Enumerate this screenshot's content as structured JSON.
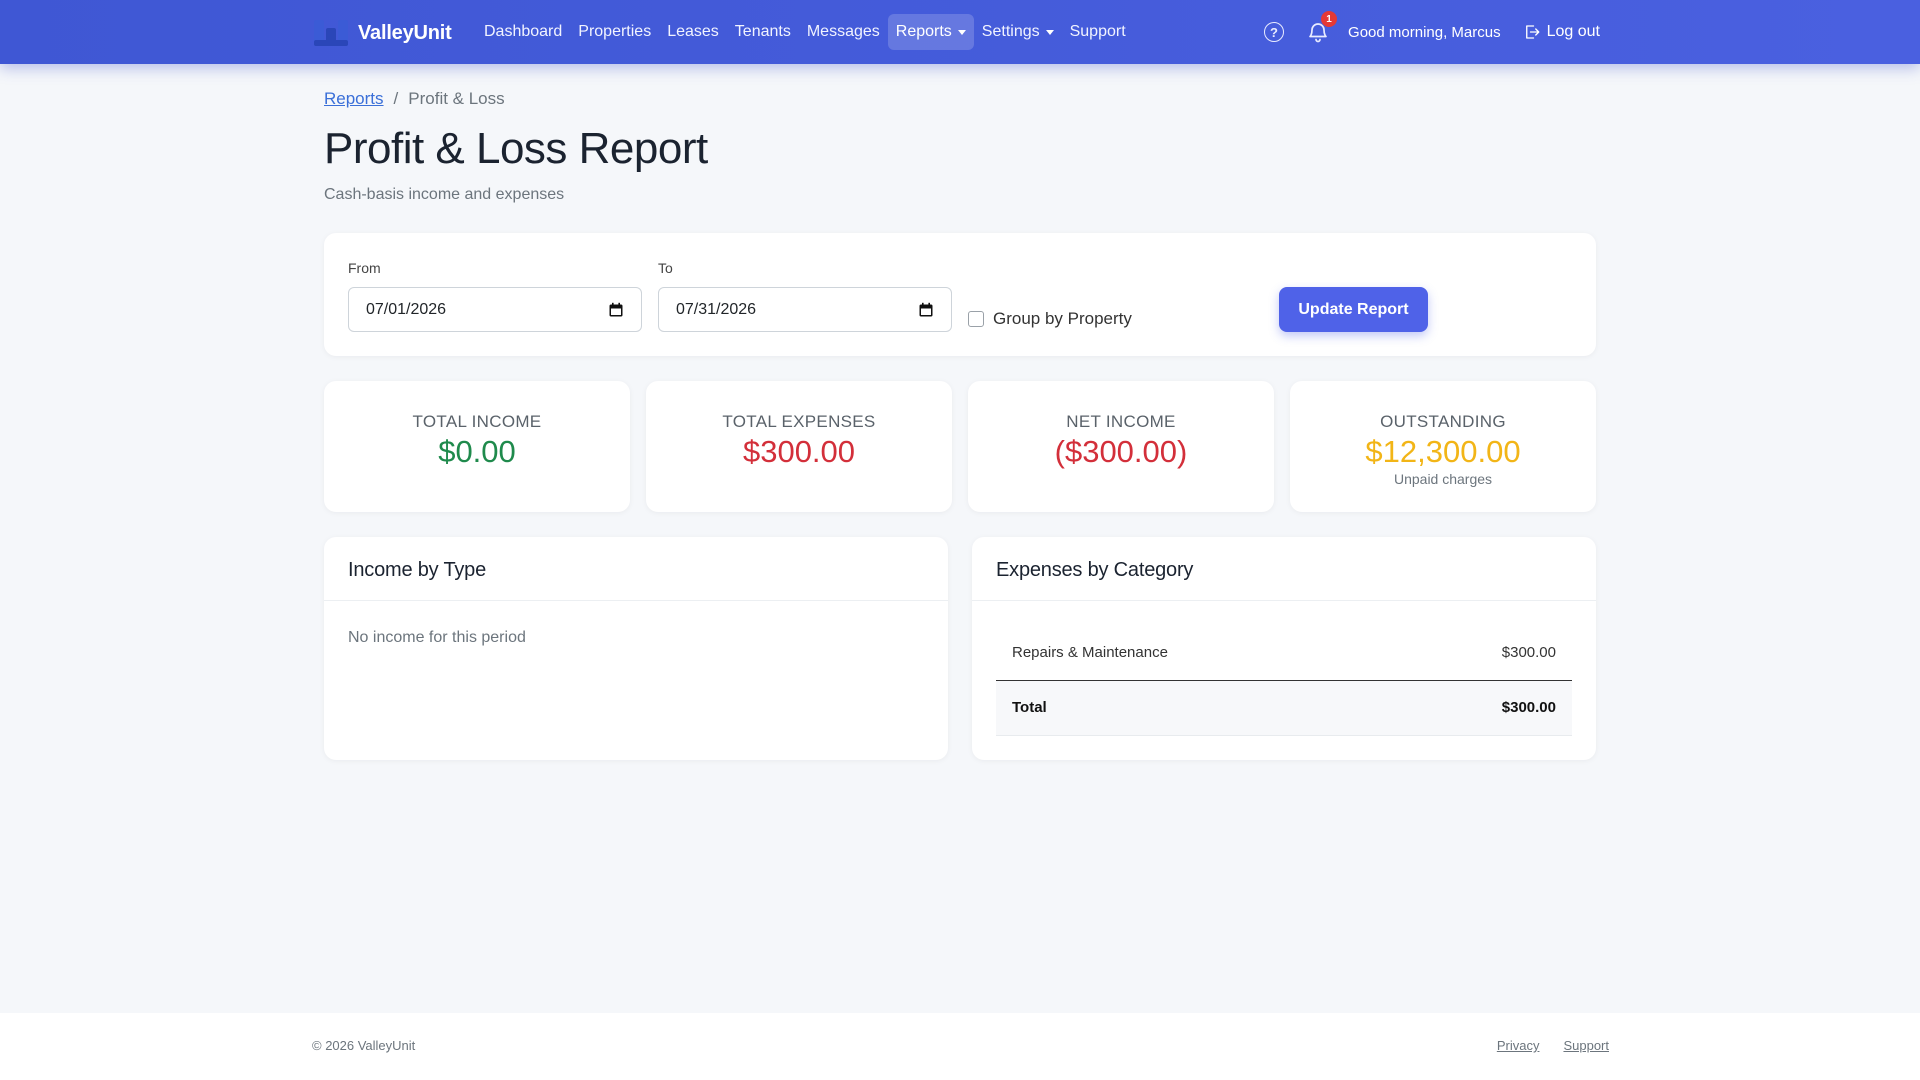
{
  "brand": {
    "name": "ValleyUnit",
    "logo_icon": "valleyunit-logo-icon"
  },
  "nav": {
    "links": [
      {
        "label": "Dashboard"
      },
      {
        "label": "Properties"
      },
      {
        "label": "Leases"
      },
      {
        "label": "Tenants"
      },
      {
        "label": "Messages"
      },
      {
        "label": "Reports",
        "active": true,
        "dropdown": true
      },
      {
        "label": "Settings",
        "dropdown": true
      },
      {
        "label": "Support"
      }
    ],
    "help_icon": "question-circle-icon",
    "notifications": {
      "icon": "bell-icon",
      "count": "1"
    },
    "greeting": "Good morning, Marcus",
    "logout": {
      "label": "Log out",
      "icon": "logout-icon"
    }
  },
  "breadcrumb": {
    "parent": "Reports",
    "separator": "/",
    "current": "Profit & Loss"
  },
  "page": {
    "title": "Profit & Loss Report",
    "subtitle": "Cash-basis income and expenses"
  },
  "filters": {
    "from": {
      "label": "From",
      "value": "07/01/2026",
      "icon": "calendar-icon"
    },
    "to": {
      "label": "To",
      "value": "07/31/2026",
      "icon": "calendar-icon"
    },
    "group_by_property": {
      "label": "Group by Property",
      "checked": false
    },
    "update_button": "Update Report"
  },
  "stats": {
    "income": {
      "label": "TOTAL INCOME",
      "value": "$0.00",
      "color": "#1f8a4c"
    },
    "expenses": {
      "label": "TOTAL EXPENSES",
      "value": "$300.00",
      "color": "#d32f3a"
    },
    "net": {
      "label": "NET INCOME",
      "value": "($300.00)",
      "color": "#d32f3a"
    },
    "outstanding": {
      "label": "OUTSTANDING",
      "value": "$12,300.00",
      "note": "Unpaid charges",
      "color": "#f2b517"
    }
  },
  "income_panel": {
    "title": "Income by Type",
    "empty": "No income for this period"
  },
  "expense_panel": {
    "title": "Expenses by Category",
    "rows": [
      {
        "category": "Repairs & Maintenance",
        "amount": "$300.00"
      }
    ],
    "total": {
      "label": "Total",
      "amount": "$300.00"
    }
  },
  "footer": {
    "copyright": "© 2026 ValleyUnit",
    "links": [
      "Privacy",
      "Support"
    ]
  },
  "colors": {
    "navbar": "#4a60e0",
    "accent": "#4f62e8",
    "link": "#3a6fd8"
  }
}
